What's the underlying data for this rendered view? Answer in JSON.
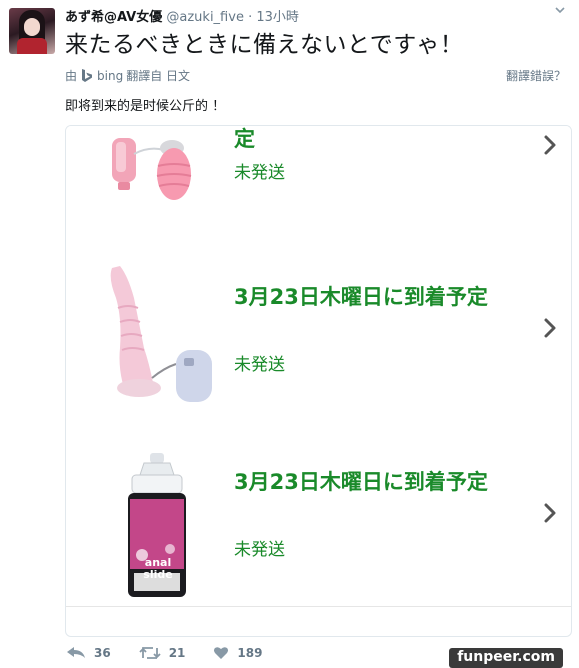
{
  "tweet": {
    "display_name": "あず希@AV女優",
    "handle": "@azuki_five",
    "separator": "·",
    "time": "13小時",
    "text": "来たるべきときに備えないとですゃ！"
  },
  "translation": {
    "by_prefix": "由",
    "provider": "bing",
    "translated_from": "翻譯自 日文",
    "wrong_translation": "翻譯錯誤？",
    "translated_text": "即将到来的是时候公斤的 ！"
  },
  "orders": [
    {
      "title": "定",
      "status": "未発送",
      "product": "pink-egg-vibrator"
    },
    {
      "title": "3月23日木曜日に到着予定",
      "status": "未発送",
      "product": "pink-dildo"
    },
    {
      "title": "3月23日木曜日に到着予定",
      "status": "未発送",
      "product": "lubricant-bottle",
      "bottle_label": "anal slide"
    }
  ],
  "actions": {
    "reply_count": "36",
    "retweet_count": "21",
    "like_count": "189"
  },
  "watermark": "funpeer.com",
  "colors": {
    "status_green": "#1a8a2a",
    "meta_gray": "#657786",
    "border": "#e1e8ed"
  },
  "icons": [
    "chevron-down-icon",
    "bing-logo-icon",
    "chevron-right-icon",
    "reply-icon",
    "retweet-icon",
    "like-icon"
  ]
}
